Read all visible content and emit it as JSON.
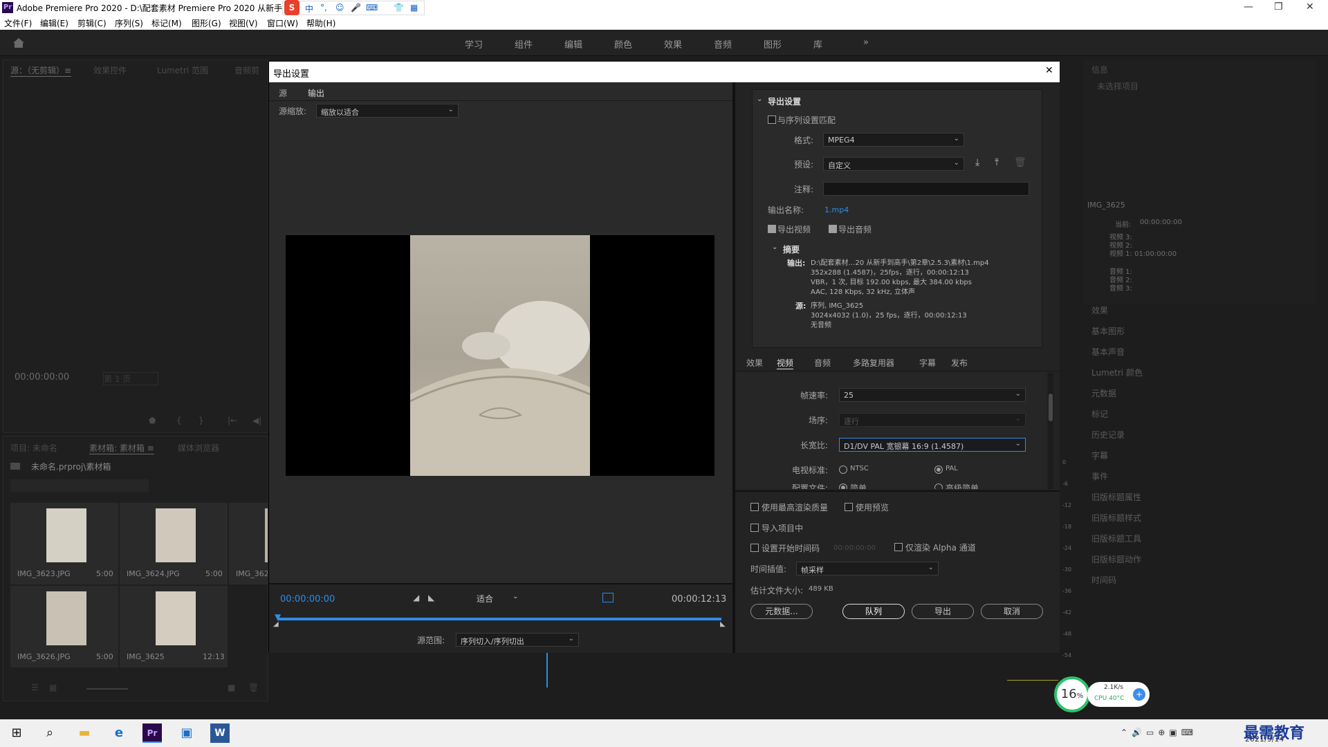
{
  "titlebar": {
    "app": "Pr",
    "title": "Adobe Premiere Pro 2020 - D:\\配套素材 Premiere Pro 2020 从新手到高手\\第2章\\2.5.3\\素材\\未命名 *",
    "min": "—",
    "max": "❐",
    "close": "✕"
  },
  "ime": {
    "items": [
      "中",
      "°,",
      "☺",
      "🎤",
      "⌨",
      "👕",
      "▦"
    ]
  },
  "menu": [
    "文件(F)",
    "编辑(E)",
    "剪辑(C)",
    "序列(S)",
    "标记(M)",
    "图形(G)",
    "视图(V)",
    "窗口(W)",
    "帮助(H)"
  ],
  "workspaces": [
    "学习",
    "组件",
    "编辑",
    "颜色",
    "效果",
    "音频",
    "图形",
    "库",
    "»"
  ],
  "source_panel": {
    "tabs": [
      "源：（无剪辑）≡",
      "效果控件",
      "Lumetri 范围",
      "音频剪"
    ],
    "timecode": "00:00:00:00",
    "page": "第 1 页"
  },
  "project_panel": {
    "tabs": [
      "项目: 未命名",
      "素材箱: 素材箱 ≡",
      "媒体浏览器"
    ],
    "path": "未命名.prproj\\素材箱",
    "items": [
      {
        "name": "IMG_3623.JPG",
        "dur": "5:00"
      },
      {
        "name": "IMG_3624.JPG",
        "dur": "5:00"
      },
      {
        "name": "IMG_362",
        "dur": ""
      },
      {
        "name": "IMG_3626.JPG",
        "dur": "5:00"
      },
      {
        "name": "IMG_3625",
        "dur": "12:13"
      }
    ]
  },
  "info_panel": {
    "title": "信息",
    "none": "未选择项目",
    "clip": "IMG_3625",
    "current_label": "当前:",
    "current": "00:00:00:00",
    "tracks": [
      "视频 3:",
      "视频 2:",
      "视频 1:  01:00:00:00",
      "音频 1:",
      "音频 2:",
      "音频 3:"
    ]
  },
  "right_list": [
    "效果",
    "基本图形",
    "基本声音",
    "Lumetri 颜色",
    "元数据",
    "标记",
    "历史记录",
    "字幕",
    "事件",
    "旧版标题属性",
    "旧版标题样式",
    "旧版标题工具",
    "旧版标题动作",
    "时间码"
  ],
  "meter_ticks": [
    "0",
    "-6",
    "-12",
    "-18",
    "-24",
    "-30",
    "-36",
    "-42",
    "-48",
    "-54"
  ],
  "dialog": {
    "title": "导出设置",
    "close": "✕",
    "tabs": [
      "源",
      "输出"
    ],
    "scale_label": "源缩放:",
    "scale_value": "缩放以适合",
    "tc_in": "00:00:00:00",
    "fit": "适合",
    "tc_out": "00:00:12:13",
    "range_label": "源范围:",
    "range_value": "序列切入/序列切出",
    "export_settings": "导出设置",
    "match_seq": "与序列设置匹配",
    "format_label": "格式:",
    "format_value": "MPEG4",
    "preset_label": "预设:",
    "preset_value": "自定义",
    "comment_label": "注释:",
    "output_name_label": "输出名称:",
    "output_name": "1.mp4",
    "export_video": "导出视频",
    "export_audio": "导出音频",
    "summary": "摘要",
    "out_label": "输出:",
    "out_lines": [
      "D:\\配套素材…20 从新手到高手\\第2章\\2.5.3\\素材\\1.mp4",
      "352x288 (1.4587)，25fps，逐行，00:00:12:13",
      "VBR，1 次, 目标 192.00 kbps, 最大 384.00 kbps",
      "AAC, 128 Kbps, 32  kHz, 立体声"
    ],
    "src_label": "源:",
    "src_lines": [
      "序列, IMG_3625",
      "3024x4032 (1.0)，25 fps，逐行，00:00:12:13",
      "无音频"
    ],
    "subtabs": [
      "效果",
      "视频",
      "音频",
      "多路复用器",
      "字幕",
      "发布"
    ],
    "fps_label": "帧速率:",
    "fps_value": "25",
    "field_label": "场序:",
    "field_value": "逐行",
    "aspect_label": "长宽比:",
    "aspect_value": "D1/DV PAL 宽银幕 16:9 (1.4587)",
    "tv_label": "电视标准:",
    "ntsc": "NTSC",
    "pal": "PAL",
    "profile_label": "配置文件:",
    "simple": "简单",
    "adv_simple": "高级简单",
    "max_quality": "使用最高渲染质量",
    "use_preview": "使用预览",
    "import_project": "导入项目中",
    "start_tc": "设置开始时间码",
    "start_tc_value": "00:00:00:00",
    "alpha_only": "仅渲染 Alpha 通道",
    "interp_label": "时间插值:",
    "interp_value": "帧采样",
    "filesize_label": "估计文件大小:",
    "filesize": "489 KB",
    "btn_metadata": "元数据...",
    "btn_queue": "队列",
    "btn_export": "导出",
    "btn_cancel": "取消"
  },
  "perf": {
    "pct": "16",
    "pct_unit": "%",
    "net": "2.1K/s",
    "cpu": "CPU 40°C"
  },
  "tray": {
    "date": "2021/9/14",
    "badge": "最需教育"
  }
}
